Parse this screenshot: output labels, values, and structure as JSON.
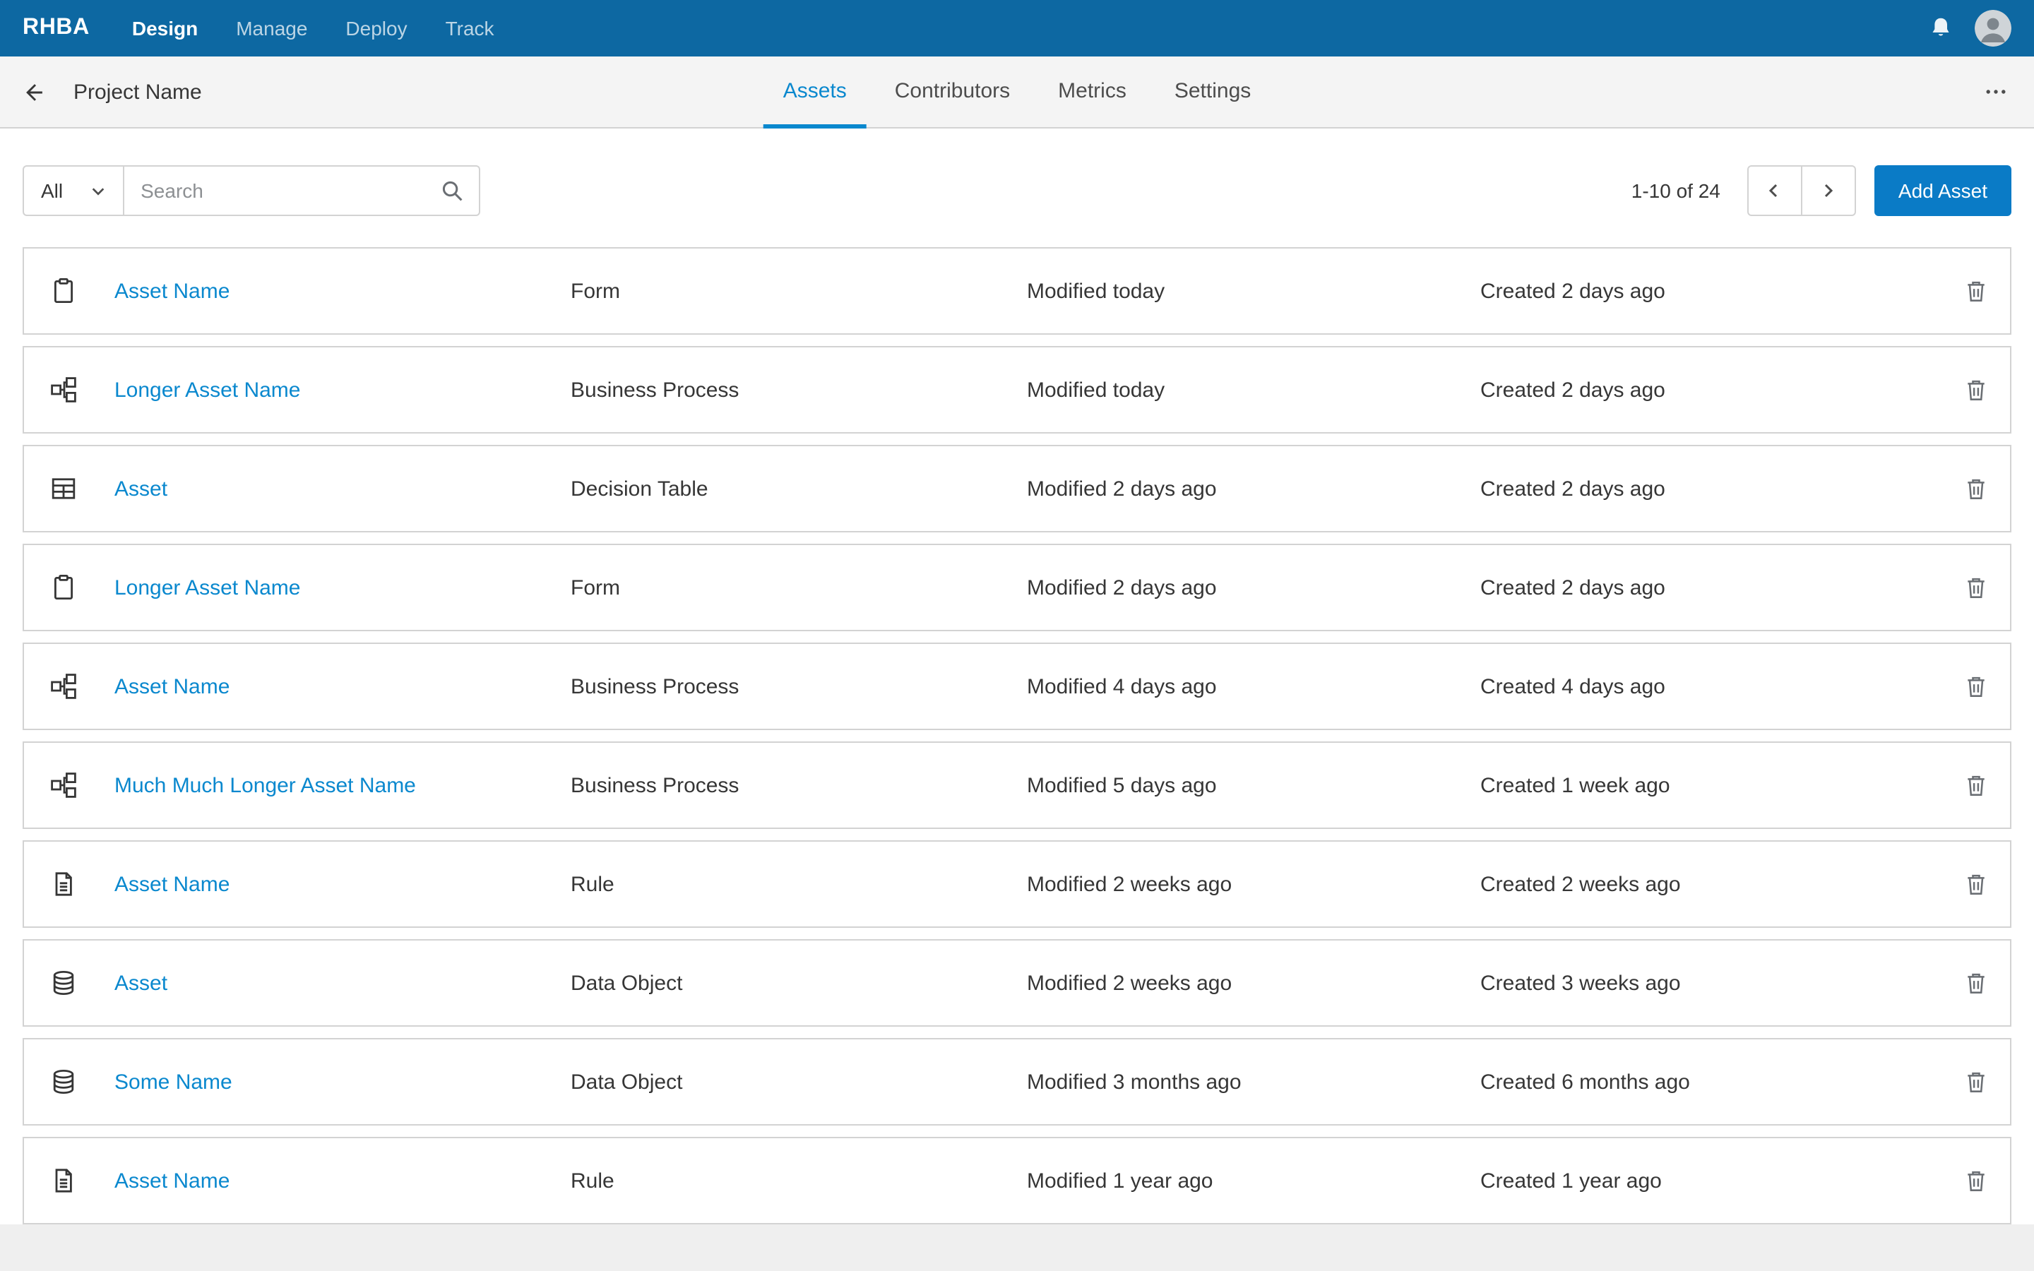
{
  "masthead": {
    "brand": "RHBA",
    "nav": [
      {
        "label": "Design",
        "active": true
      },
      {
        "label": "Manage",
        "active": false
      },
      {
        "label": "Deploy",
        "active": false
      },
      {
        "label": "Track",
        "active": false
      }
    ],
    "notifications_icon": "bell-icon",
    "user_icon": "avatar"
  },
  "header": {
    "back_icon": "arrow-left-icon",
    "title": "Project Name",
    "tabs": [
      {
        "label": "Assets",
        "active": true
      },
      {
        "label": "Contributors",
        "active": false
      },
      {
        "label": "Metrics",
        "active": false
      },
      {
        "label": "Settings",
        "active": false
      }
    ],
    "overflow_icon": "kebab-menu-icon"
  },
  "toolbar": {
    "filter": {
      "value": "All",
      "icon": "chevron-down-icon"
    },
    "search": {
      "placeholder": "Search",
      "icon": "search-icon"
    },
    "pagination": {
      "range": "1-10 of 24",
      "prev_icon": "chevron-left-icon",
      "next_icon": "chevron-right-icon"
    },
    "add_button_label": "Add Asset"
  },
  "list": {
    "delete_icon": "trash-icon"
  },
  "assets": [
    {
      "icon": "form",
      "name": "Asset Name",
      "type": "Form",
      "modified": "Modified today",
      "created": "Created 2 days ago"
    },
    {
      "icon": "business-process",
      "name": "Longer Asset Name",
      "type": "Business Process",
      "modified": "Modified today",
      "created": "Created 2 days ago"
    },
    {
      "icon": "decision-table",
      "name": "Asset",
      "type": "Decision Table",
      "modified": "Modified 2 days ago",
      "created": "Created 2 days ago"
    },
    {
      "icon": "form",
      "name": "Longer Asset Name",
      "type": "Form",
      "modified": "Modified 2 days ago",
      "created": "Created 2 days ago"
    },
    {
      "icon": "business-process",
      "name": "Asset Name",
      "type": "Business Process",
      "modified": "Modified 4 days ago",
      "created": "Created 4 days ago"
    },
    {
      "icon": "business-process",
      "name": "Much Much Longer Asset Name",
      "type": "Business Process",
      "modified": "Modified 5 days ago",
      "created": "Created 1 week ago"
    },
    {
      "icon": "rule",
      "name": "Asset Name",
      "type": "Rule",
      "modified": "Modified 2 weeks ago",
      "created": "Created 2 weeks ago"
    },
    {
      "icon": "data-object",
      "name": "Asset",
      "type": "Data Object",
      "modified": "Modified 2 weeks ago",
      "created": "Created 3 weeks ago"
    },
    {
      "icon": "data-object",
      "name": "Some Name",
      "type": "Data Object",
      "modified": "Modified 3 months ago",
      "created": "Created 6 months ago"
    },
    {
      "icon": "rule",
      "name": "Asset Name",
      "type": "Rule",
      "modified": "Modified 1 year ago",
      "created": "Created 1 year ago"
    }
  ],
  "colors": {
    "masthead_bg": "#0d68a2",
    "header_bg": "#f4f4f4",
    "link": "#0a88ce",
    "tab_active": "#0a88ce",
    "primary_button": "#0a7bc6",
    "row_border": "#d3d3d3"
  }
}
